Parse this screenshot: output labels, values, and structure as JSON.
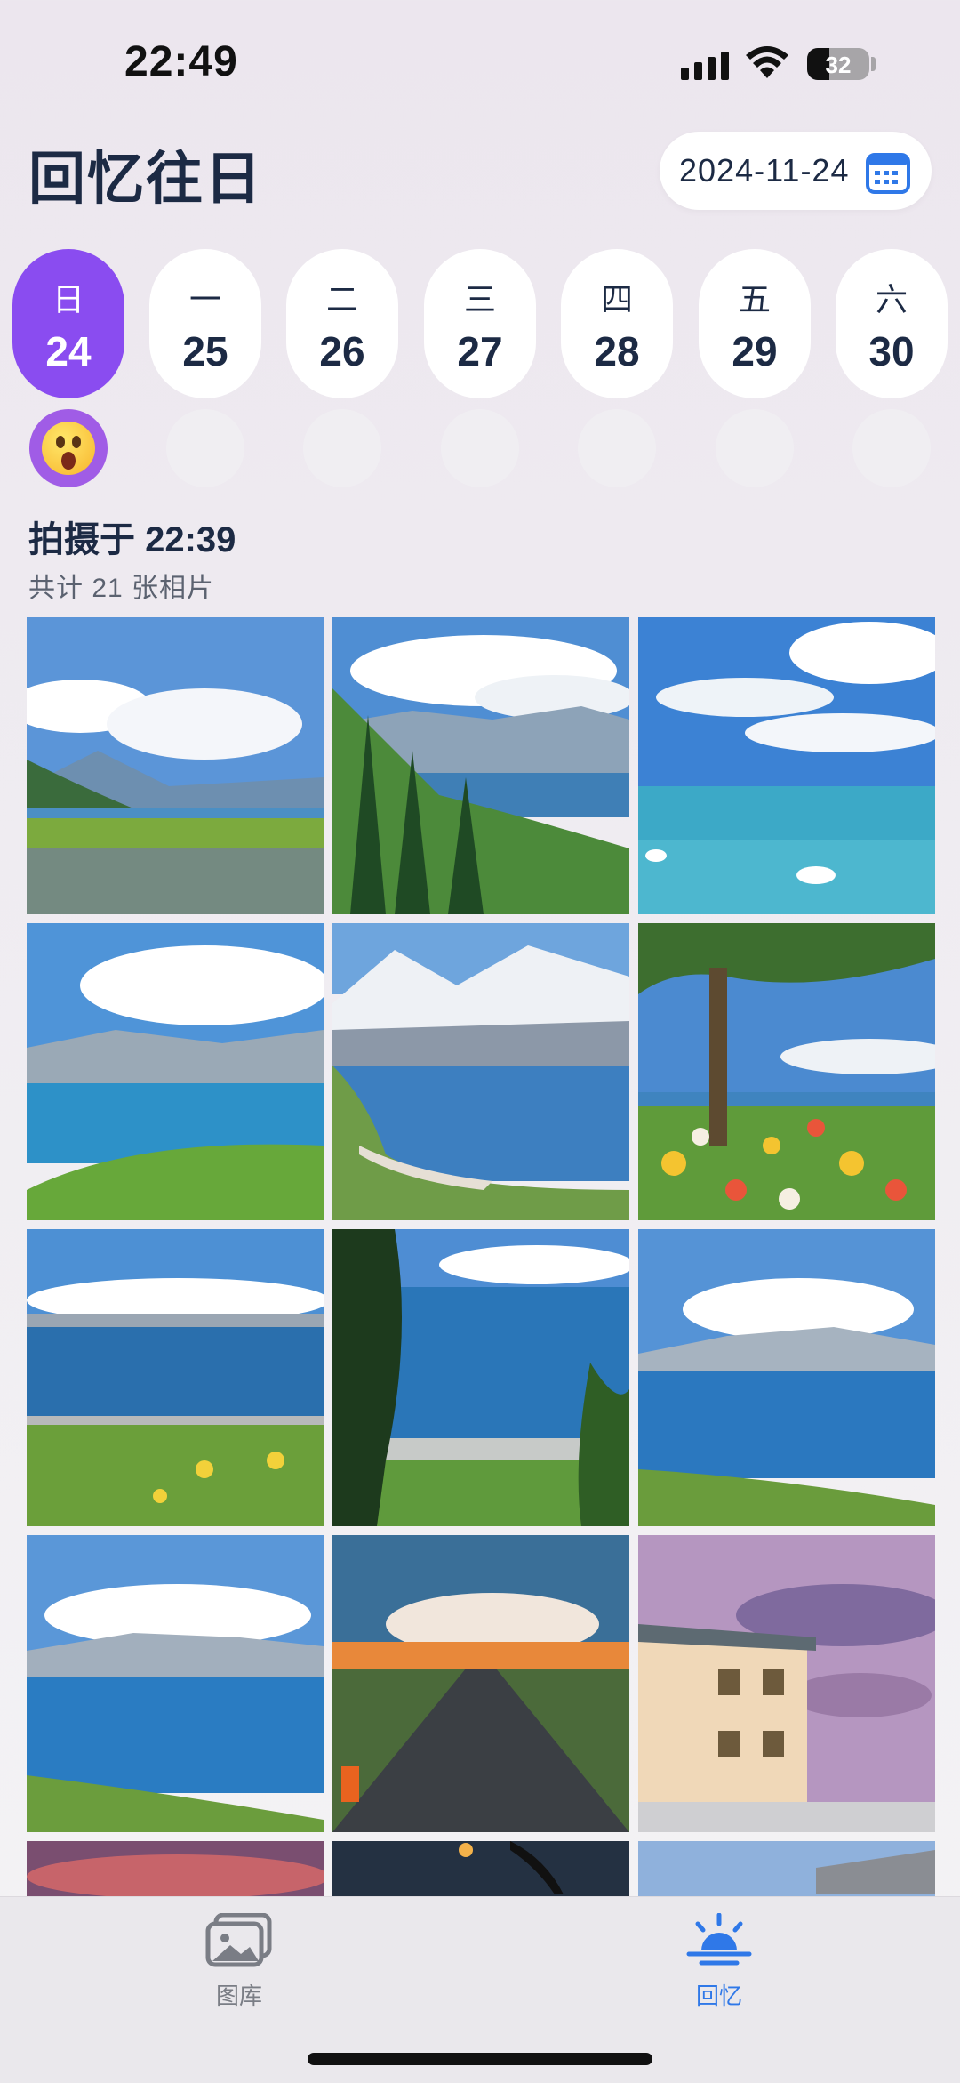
{
  "status_bar": {
    "time": "22:49",
    "battery": "32"
  },
  "header": {
    "title": "回忆往日",
    "date": "2024-11-24"
  },
  "week": [
    {
      "weekday": "日",
      "day": "24",
      "selected": true
    },
    {
      "weekday": "一",
      "day": "25",
      "selected": false
    },
    {
      "weekday": "二",
      "day": "26",
      "selected": false
    },
    {
      "weekday": "三",
      "day": "27",
      "selected": false
    },
    {
      "weekday": "四",
      "day": "28",
      "selected": false
    },
    {
      "weekday": "五",
      "day": "29",
      "selected": false
    },
    {
      "weekday": "六",
      "day": "30",
      "selected": false
    }
  ],
  "moods": [
    "surprised-emoji",
    "",
    "",
    "",
    "",
    "",
    ""
  ],
  "section": {
    "taken_at": "拍摄于 22:39",
    "count_text": "共计 21 张相片"
  },
  "photos": [
    "lake-meadow-flowers",
    "lake-pine-slope",
    "lake-swans",
    "lake-green-shore",
    "snow-mountain-lake",
    "tree-poppies",
    "lake-yellow-flowers",
    "lake-through-trees",
    "lake-cloud-shore",
    "lake-cloud-shore-2",
    "highway-sunset",
    "building-pink-sky",
    "sunset-sky",
    "palm-dusk",
    "blue-sky-roof"
  ],
  "tab_bar": {
    "tabs": [
      {
        "label": "图库",
        "icon": "photos-icon",
        "active": false
      },
      {
        "label": "回忆",
        "icon": "sunrise-icon",
        "active": true
      }
    ]
  },
  "colors": {
    "accent": "#8a4cf0",
    "tab_active": "#2f78e8",
    "title": "#1c2a44"
  }
}
